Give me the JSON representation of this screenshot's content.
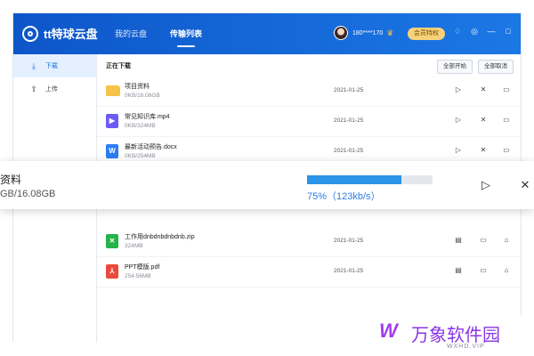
{
  "app": {
    "logo_text": "tt特球云盘",
    "nav": [
      "我的云盘",
      "传输列表"
    ],
    "user": "180****170",
    "vip_label": "会员特权"
  },
  "sidebar": {
    "items": [
      "下载",
      "上传"
    ]
  },
  "main": {
    "section_title": "正在下载",
    "start_all": "全部开始",
    "cancel_all": "全部取消",
    "rows": [
      {
        "name": "项目资料",
        "size": "0KB/16.08GB",
        "date": "2021-01-25",
        "type": "folder",
        "glyph": ""
      },
      {
        "name": "常见知识库.mp4",
        "size": "0KB/324MB",
        "date": "2021-01-25",
        "type": "video",
        "glyph": "▶"
      },
      {
        "name": "最新活动预告.docx",
        "size": "0KB/254MB",
        "date": "2021-01-25",
        "type": "word",
        "glyph": "W"
      },
      {
        "name": "工作用dnbdnbdnbdnb.zip",
        "size": "324MB",
        "date": "2021-01-25",
        "type": "zip",
        "glyph": "✕"
      },
      {
        "name": "PPT模版.pdf",
        "size": "254.56MB",
        "date": "2021-01-25",
        "type": "pdf",
        "glyph": "⅄"
      }
    ]
  },
  "overlay": {
    "name": "资料",
    "size": "GB/16.08GB",
    "progress": 0.75,
    "percent_text": "75%（123kb/s）"
  },
  "watermark": {
    "brand": "万象软件园",
    "url": "WXHD.VIP"
  },
  "colors": {
    "accent": "#1a6ce5",
    "progress": "#2b93e8",
    "vip": "#f8d27a"
  }
}
